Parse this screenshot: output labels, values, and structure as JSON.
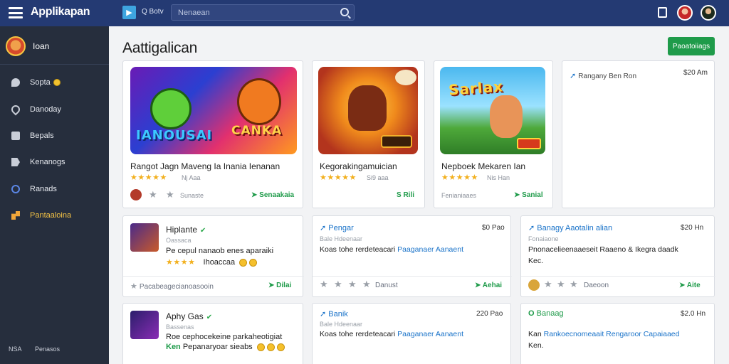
{
  "app": {
    "title": "Applikapan"
  },
  "search": {
    "scope": "Q Botv",
    "placeholder": "Nenaean"
  },
  "sidebar": {
    "user": "Ioan",
    "items": [
      {
        "label": "Sopta",
        "icon": "chat-icon"
      },
      {
        "label": "Danoday",
        "icon": "pin-icon"
      },
      {
        "label": "Bepals",
        "icon": "box-icon"
      },
      {
        "label": "Kenanogs",
        "icon": "tag-icon"
      },
      {
        "label": "Ranads",
        "icon": "search-icon"
      },
      {
        "label": "Pantaaloina",
        "icon": "key-icon"
      }
    ],
    "bottom": {
      "key": "NSA",
      "label": "Penasos"
    }
  },
  "page": {
    "title": "Aattigalican",
    "action_label": "Paoatoiiags"
  },
  "featured": [
    {
      "banner_text": "IANOUSAI",
      "banner_text2": "CANKA",
      "title": "Rangot Jagn Maveng Ia Inania Ienanan",
      "stars": "★★★★★",
      "sub": "Nj Aaa",
      "footer": "Sunaste",
      "price": "Senaakaia"
    },
    {
      "banner_text": "",
      "title": "Kegorakingamuician",
      "stars": "★★★★★",
      "sub": "Si9 aaa",
      "price": "S Rili"
    },
    {
      "banner_text": "Sarlax",
      "title": "Nepboek Mekaren Ian",
      "stars": "★★★★★",
      "sub": "Nis Han",
      "footer": "Fenianiaaes",
      "price": "Sanial"
    },
    {
      "title": "Rangany Ben Ron",
      "price": "$20 Am"
    }
  ],
  "row2": [
    {
      "title": "Hiplante",
      "sub": "Oassaca",
      "desc": "Pe cepul nanaob enes aparaiki",
      "desc2": "Ihoaccaa",
      "stars": "★★★★",
      "footer": "Pacabeagecianoasooin",
      "price": "Dilai"
    },
    {
      "title": "Pengar",
      "price_top": "$0 Pao",
      "sub": "Bale Hdeenaar",
      "desc": "Koas tohe rerdeteacari",
      "link": "Paaganaer Aanaent",
      "footer": "Danust",
      "price": "Aehai"
    },
    {
      "title": "Banagy Aaotalin alian",
      "price_top": "$20 Hn",
      "sub": "Fonaiaone",
      "desc": "Pnonacelieenaaeseit Raaeno & Ikegra daadk",
      "desc2": "Kec.",
      "footer": "Daeoon",
      "price": "Aite"
    }
  ],
  "row3": [
    {
      "title": "Aphy Gas",
      "sub": "Bassenas",
      "desc": "Roe cephocekeine parkaheotigiat",
      "desc2": "Pepanaryoar sieabs",
      "desc2_pre": "Ken"
    },
    {
      "title": "Banik",
      "price_top": "220 Pao",
      "sub": "Bale Hdeenaar",
      "desc": "Koas tohe rerdeteacari",
      "link": "Paaganaer Aanaent"
    },
    {
      "title": "Banaag",
      "price_top": "$2.0 Hn",
      "desc_pre": "Kan",
      "link": "Rankoecnomeaait Rengaroor Capaiaaed",
      "desc2": "Ken."
    }
  ],
  "colors": {
    "topbar": "#243a73",
    "sidebar": "#262e3d",
    "accent": "#1f9b4a",
    "link": "#1a73c9",
    "star": "#f2b01e"
  }
}
